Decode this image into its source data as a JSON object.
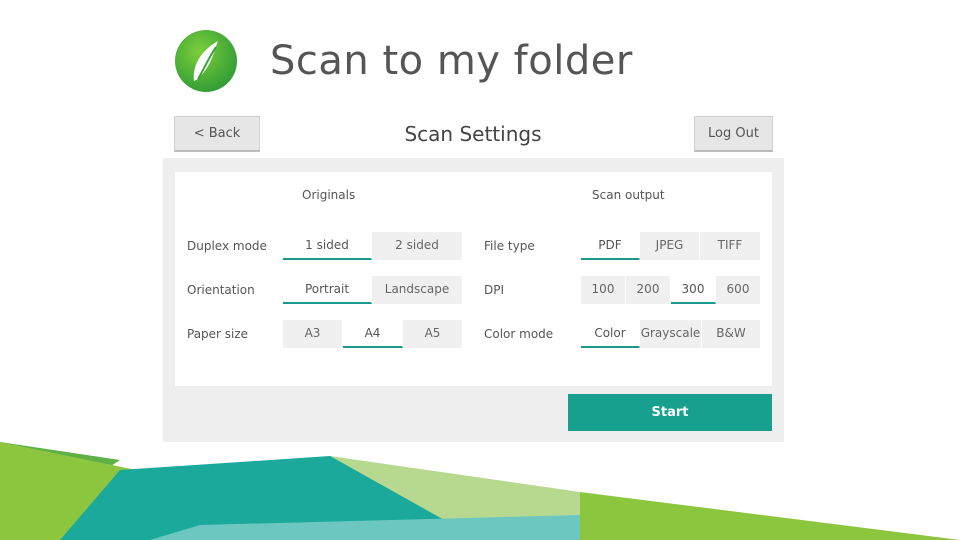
{
  "slide": {
    "title": "Scan to my folder"
  },
  "header": {
    "title": "Scan Settings",
    "back_label": "< Back",
    "logout_label": "Log Out"
  },
  "originals": {
    "heading": "Originals",
    "rows": [
      {
        "label": "Duplex mode",
        "options": [
          "1 sided",
          "2 sided"
        ],
        "selected": "1 sided"
      },
      {
        "label": "Orientation",
        "options": [
          "Portrait",
          "Landscape"
        ],
        "selected": "Portrait"
      },
      {
        "label": "Paper size",
        "options": [
          "A3",
          "A4",
          "A5"
        ],
        "selected": "A4"
      }
    ]
  },
  "output": {
    "heading": "Scan output",
    "rows": [
      {
        "label": "File type",
        "options": [
          "PDF",
          "JPEG",
          "TIFF"
        ],
        "selected": "PDF"
      },
      {
        "label": "DPI",
        "options": [
          "100",
          "200",
          "300",
          "600"
        ],
        "selected": "300"
      },
      {
        "label": "Color mode",
        "options": [
          "Color",
          "Grayscale",
          "B&W"
        ],
        "selected": "Color"
      }
    ]
  },
  "start_label": "Start",
  "colors": {
    "accent": "#18a08f",
    "leaf_green": "#4caf3c",
    "band_green": "#8cc63f",
    "band_teal": "#1aa99a"
  }
}
